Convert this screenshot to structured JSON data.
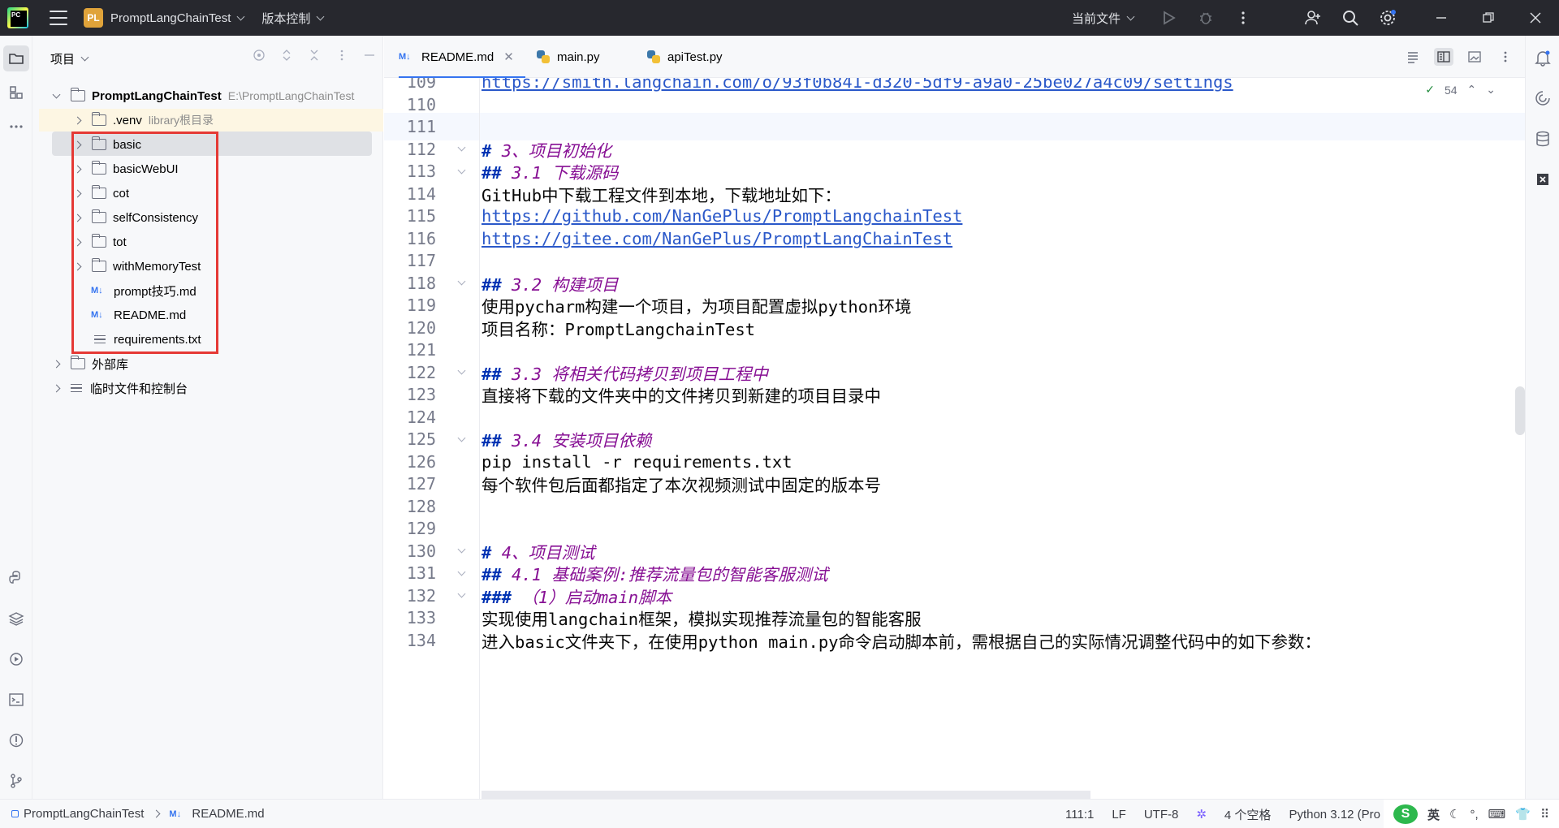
{
  "titlebar": {
    "project_badge": "PL",
    "project_name": "PromptLangChainTest",
    "vcs_label": "版本控制",
    "current_file_label": "当前文件"
  },
  "project_panel": {
    "title": "项目",
    "root": {
      "name": "PromptLangChainTest",
      "path": "E:\\PromptLangChainTest"
    },
    "venv": {
      "name": ".venv",
      "note": "library根目录"
    },
    "folders": [
      "basic",
      "basicWebUI",
      "cot",
      "selfConsistency",
      "tot",
      "withMemoryTest"
    ],
    "files": [
      {
        "icon": "M↓",
        "name": "prompt技巧.md"
      },
      {
        "icon": "M↓",
        "name": "README.md"
      },
      {
        "icon": "txt",
        "name": "requirements.txt"
      }
    ],
    "external_libs": "外部库",
    "scratches": "临时文件和控制台"
  },
  "tabs": [
    {
      "icon": "M↓",
      "label": "README.md",
      "active": true
    },
    {
      "icon": "python",
      "label": "main.py",
      "active": false
    },
    {
      "icon": "python",
      "label": "apiTest.py",
      "active": false
    }
  ],
  "editor": {
    "inspection_count": "54",
    "current_line": 111,
    "lines": [
      {
        "n": "109",
        "hash": "",
        "text": "https://smith.langchain.com/o/93f0b841-d320-5df9-a9a0-25be027a4c09/settings",
        "kind": "link"
      },
      {
        "n": "110",
        "hash": "",
        "text": "",
        "kind": "plain"
      },
      {
        "n": "111",
        "hash": "",
        "text": "",
        "kind": "plain"
      },
      {
        "n": "112",
        "hash": "# ",
        "text": "3、项目初始化",
        "kind": "heading"
      },
      {
        "n": "113",
        "hash": "## ",
        "text": "3.1 下载源码",
        "kind": "heading"
      },
      {
        "n": "114",
        "hash": "",
        "text": "GitHub中下载工程文件到本地，下载地址如下：",
        "kind": "plain"
      },
      {
        "n": "115",
        "hash": "",
        "text": "https://github.com/NanGePlus/PromptLangchainTest",
        "kind": "link"
      },
      {
        "n": "116",
        "hash": "",
        "text": "https://gitee.com/NanGePlus/PromptLangChainTest",
        "kind": "link"
      },
      {
        "n": "117",
        "hash": "",
        "text": "",
        "kind": "plain"
      },
      {
        "n": "118",
        "hash": "## ",
        "text": "3.2 构建项目",
        "kind": "heading"
      },
      {
        "n": "119",
        "hash": "",
        "text": "使用pycharm构建一个项目，为项目配置虚拟python环境",
        "kind": "plain"
      },
      {
        "n": "120",
        "hash": "",
        "text": "项目名称：PromptLangchainTest",
        "kind": "plain"
      },
      {
        "n": "121",
        "hash": "",
        "text": "",
        "kind": "plain"
      },
      {
        "n": "122",
        "hash": "## ",
        "text": "3.3 将相关代码拷贝到项目工程中",
        "kind": "heading"
      },
      {
        "n": "123",
        "hash": "",
        "text": "直接将下载的文件夹中的文件拷贝到新建的项目目录中",
        "kind": "plain"
      },
      {
        "n": "124",
        "hash": "",
        "text": "",
        "kind": "plain"
      },
      {
        "n": "125",
        "hash": "## ",
        "text": "3.4 安装项目依赖",
        "kind": "heading"
      },
      {
        "n": "126",
        "hash": "",
        "text": "pip install -r requirements.txt",
        "kind": "plain"
      },
      {
        "n": "127",
        "hash": "",
        "text": "每个软件包后面都指定了本次视频测试中固定的版本号",
        "kind": "plain"
      },
      {
        "n": "128",
        "hash": "",
        "text": "",
        "kind": "plain"
      },
      {
        "n": "129",
        "hash": "",
        "text": "",
        "kind": "plain"
      },
      {
        "n": "130",
        "hash": "# ",
        "text": "4、项目测试",
        "kind": "heading"
      },
      {
        "n": "131",
        "hash": "## ",
        "text": "4.1 基础案例:推荐流量包的智能客服测试",
        "kind": "heading"
      },
      {
        "n": "132",
        "hash": "### ",
        "text": "（1）启动main脚本",
        "kind": "heading"
      },
      {
        "n": "133",
        "hash": "",
        "text": "实现使用langchain框架，模拟实现推荐流量包的智能客服",
        "kind": "plain"
      },
      {
        "n": "134",
        "hash": "",
        "text": "进入basic文件夹下，在使用python main.py命令启动脚本前，需根据自己的实际情况调整代码中的如下参数：",
        "kind": "plain"
      }
    ]
  },
  "statusbar": {
    "crumb_project": "PromptLangChainTest",
    "crumb_file": "README.md",
    "position": "111:1",
    "line_sep": "LF",
    "encoding": "UTF-8",
    "indent": "4 个空格",
    "interpreter": "Python 3.12 (Pro",
    "ime_lang": "英"
  },
  "colors": {
    "accent": "#3574f0",
    "highlight_box": "#e53935",
    "heading": "#871094",
    "markdown_hash": "#0033b3",
    "link": "#2a58c9"
  }
}
